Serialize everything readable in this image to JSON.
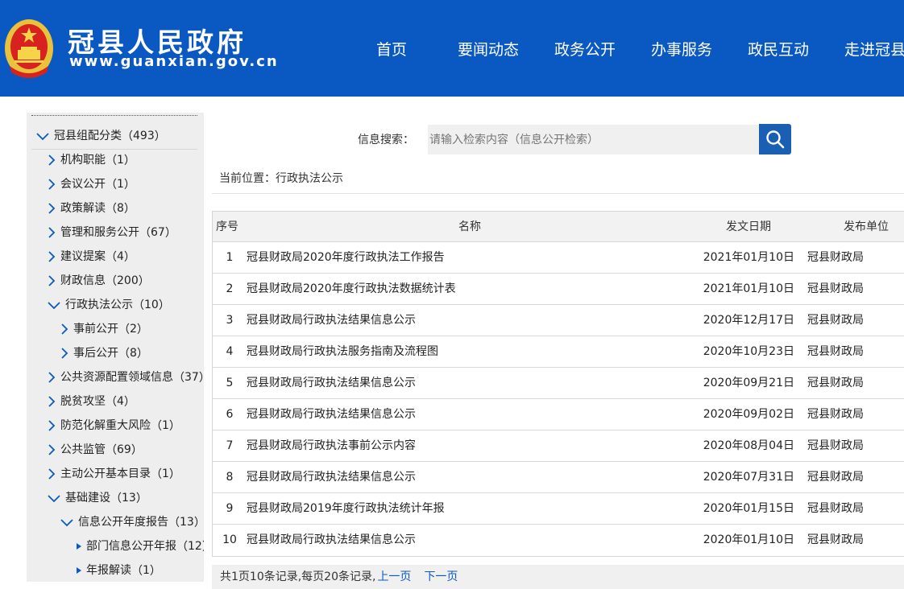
{
  "header": {
    "site_name": "冠县人民政府",
    "site_url": "www.guanxian.gov.cn",
    "nav": [
      "首页",
      "要闻动态",
      "政务公开",
      "办事服务",
      "政民互动",
      "走进冠县"
    ]
  },
  "sidebar": {
    "items": [
      {
        "label": "冠县组配分类",
        "count": "493",
        "level": 0,
        "expanded": true
      },
      {
        "label": "机构职能",
        "count": "1",
        "level": 1,
        "expanded": false
      },
      {
        "label": "会议公开",
        "count": "1",
        "level": 1,
        "expanded": false
      },
      {
        "label": "政策解读",
        "count": "8",
        "level": 1,
        "expanded": false
      },
      {
        "label": "管理和服务公开",
        "count": "67",
        "level": 1,
        "expanded": false
      },
      {
        "label": "建议提案",
        "count": "4",
        "level": 1,
        "expanded": false
      },
      {
        "label": "财政信息",
        "count": "200",
        "level": 1,
        "expanded": false
      },
      {
        "label": "行政执法公示",
        "count": "10",
        "level": 1,
        "expanded": true
      },
      {
        "label": "事前公开",
        "count": "2",
        "level": 2,
        "expanded": false
      },
      {
        "label": "事后公开",
        "count": "8",
        "level": 2,
        "expanded": false
      },
      {
        "label": "公共资源配置领域信息",
        "count": "37",
        "level": 1,
        "expanded": false
      },
      {
        "label": "脱贫攻坚",
        "count": "4",
        "level": 1,
        "expanded": false
      },
      {
        "label": "防范化解重大风险",
        "count": "1",
        "level": 1,
        "expanded": false
      },
      {
        "label": "公共监管",
        "count": "69",
        "level": 1,
        "expanded": false
      },
      {
        "label": "主动公开基本目录",
        "count": "1",
        "level": 1,
        "expanded": false
      },
      {
        "label": "基础建设",
        "count": "13",
        "level": 1,
        "expanded": true
      },
      {
        "label": "信息公开年度报告",
        "count": "13",
        "level": 2,
        "expanded": true
      },
      {
        "label": "部门信息公开年报",
        "count": "12",
        "level": 3,
        "leaf": true
      },
      {
        "label": "年报解读",
        "count": "1",
        "level": 3,
        "leaf": true
      }
    ]
  },
  "search": {
    "label": "信息搜索：",
    "placeholder": "请输入检索内容（信息公开检索）"
  },
  "breadcrumb": "当前位置：行政执法公示",
  "table": {
    "headers": {
      "no": "序号",
      "name": "名称",
      "date": "发文日期",
      "unit": "发布单位"
    },
    "rows": [
      {
        "no": "1",
        "name": "冠县财政局2020年度行政执法工作报告",
        "date": "2021年01月10日",
        "unit": "冠县财政局"
      },
      {
        "no": "2",
        "name": "冠县财政局2020年度行政执法数据统计表",
        "date": "2021年01月10日",
        "unit": "冠县财政局"
      },
      {
        "no": "3",
        "name": "冠县财政局行政执法结果信息公示",
        "date": "2020年12月17日",
        "unit": "冠县财政局"
      },
      {
        "no": "4",
        "name": "冠县财政局行政执法服务指南及流程图",
        "date": "2020年10月23日",
        "unit": "冠县财政局"
      },
      {
        "no": "5",
        "name": "冠县财政局行政执法结果信息公示",
        "date": "2020年09月21日",
        "unit": "冠县财政局"
      },
      {
        "no": "6",
        "name": "冠县财政局行政执法结果信息公示",
        "date": "2020年09月02日",
        "unit": "冠县财政局"
      },
      {
        "no": "7",
        "name": "冠县财政局行政执法事前公示内容",
        "date": "2020年08月04日",
        "unit": "冠县财政局"
      },
      {
        "no": "8",
        "name": "冠县财政局行政执法结果信息公示",
        "date": "2020年07月31日",
        "unit": "冠县财政局"
      },
      {
        "no": "9",
        "name": "冠县财政局2019年度行政执法统计年报",
        "date": "2020年01月15日",
        "unit": "冠县财政局"
      },
      {
        "no": "10",
        "name": "冠县财政局行政执法结果信息公示",
        "date": "2020年01月10日",
        "unit": "冠县财政局"
      }
    ]
  },
  "pager": {
    "summary": "共1页10条记录,每页20条记录,",
    "prev": "上一页",
    "next": "下一页"
  },
  "colors": {
    "brand_blue": "#0a58c2",
    "sidebar_bg": "#eeeeee"
  }
}
